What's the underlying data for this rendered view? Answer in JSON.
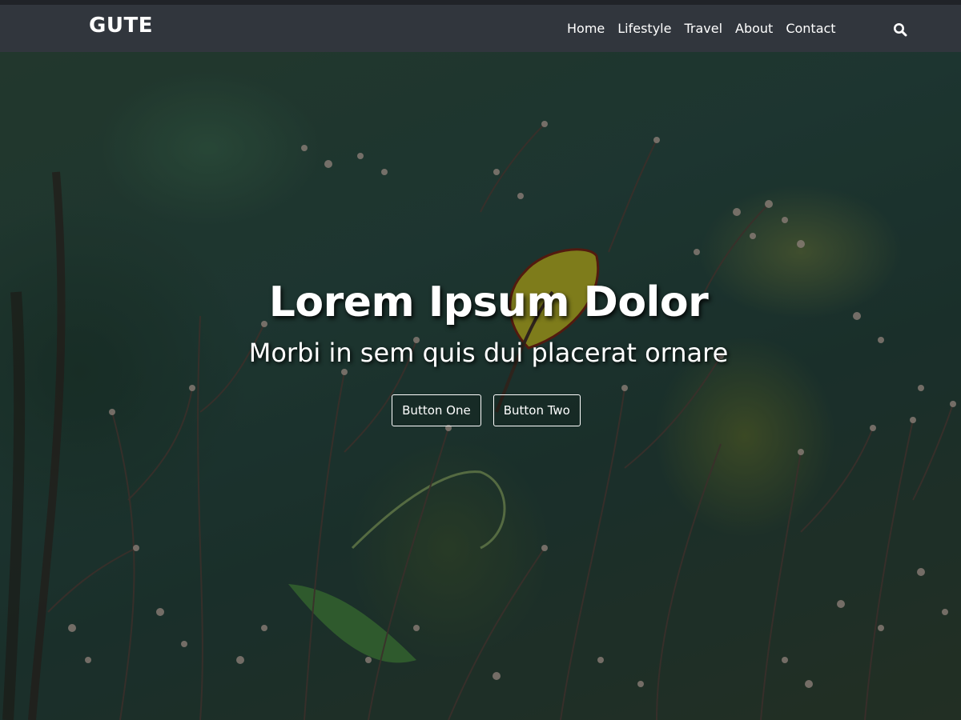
{
  "header": {
    "brand": "GUTE",
    "nav": [
      {
        "label": "Home"
      },
      {
        "label": "Lifestyle"
      },
      {
        "label": "Travel"
      },
      {
        "label": "About"
      },
      {
        "label": "Contact"
      }
    ],
    "search_icon": "search-icon",
    "background_color": "#31363d"
  },
  "hero": {
    "title": "Lorem Ipsum Dolor",
    "subtitle": "Morbi in sem quis dui placerat ornare",
    "buttons": [
      {
        "label": "Button One"
      },
      {
        "label": "Button Two"
      }
    ]
  }
}
